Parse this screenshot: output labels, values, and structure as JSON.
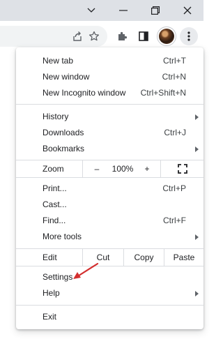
{
  "window": {
    "icons": [
      "chevron-down-icon",
      "minimize-icon",
      "restore-icon",
      "close-icon"
    ]
  },
  "toolbar": {
    "icons": [
      "share-icon",
      "bookmark-star-icon",
      "extensions-icon",
      "side-panel-icon",
      "profile-avatar",
      "more-menu-icon"
    ]
  },
  "menu": {
    "new_tab": {
      "label": "New tab",
      "shortcut": "Ctrl+T"
    },
    "new_window": {
      "label": "New window",
      "shortcut": "Ctrl+N"
    },
    "new_incognito": {
      "label": "New Incognito window",
      "shortcut": "Ctrl+Shift+N"
    },
    "history": {
      "label": "History"
    },
    "downloads": {
      "label": "Downloads",
      "shortcut": "Ctrl+J"
    },
    "bookmarks": {
      "label": "Bookmarks"
    },
    "zoom": {
      "label": "Zoom",
      "minus": "–",
      "value": "100%",
      "plus": "+"
    },
    "print": {
      "label": "Print...",
      "shortcut": "Ctrl+P"
    },
    "cast": {
      "label": "Cast..."
    },
    "find": {
      "label": "Find...",
      "shortcut": "Ctrl+F"
    },
    "more_tools": {
      "label": "More tools"
    },
    "edit": {
      "label": "Edit",
      "cut": "Cut",
      "copy": "Copy",
      "paste": "Paste"
    },
    "settings": {
      "label": "Settings"
    },
    "help": {
      "label": "Help"
    },
    "exit": {
      "label": "Exit"
    }
  },
  "annotation": {
    "color": "#d32f2f"
  }
}
